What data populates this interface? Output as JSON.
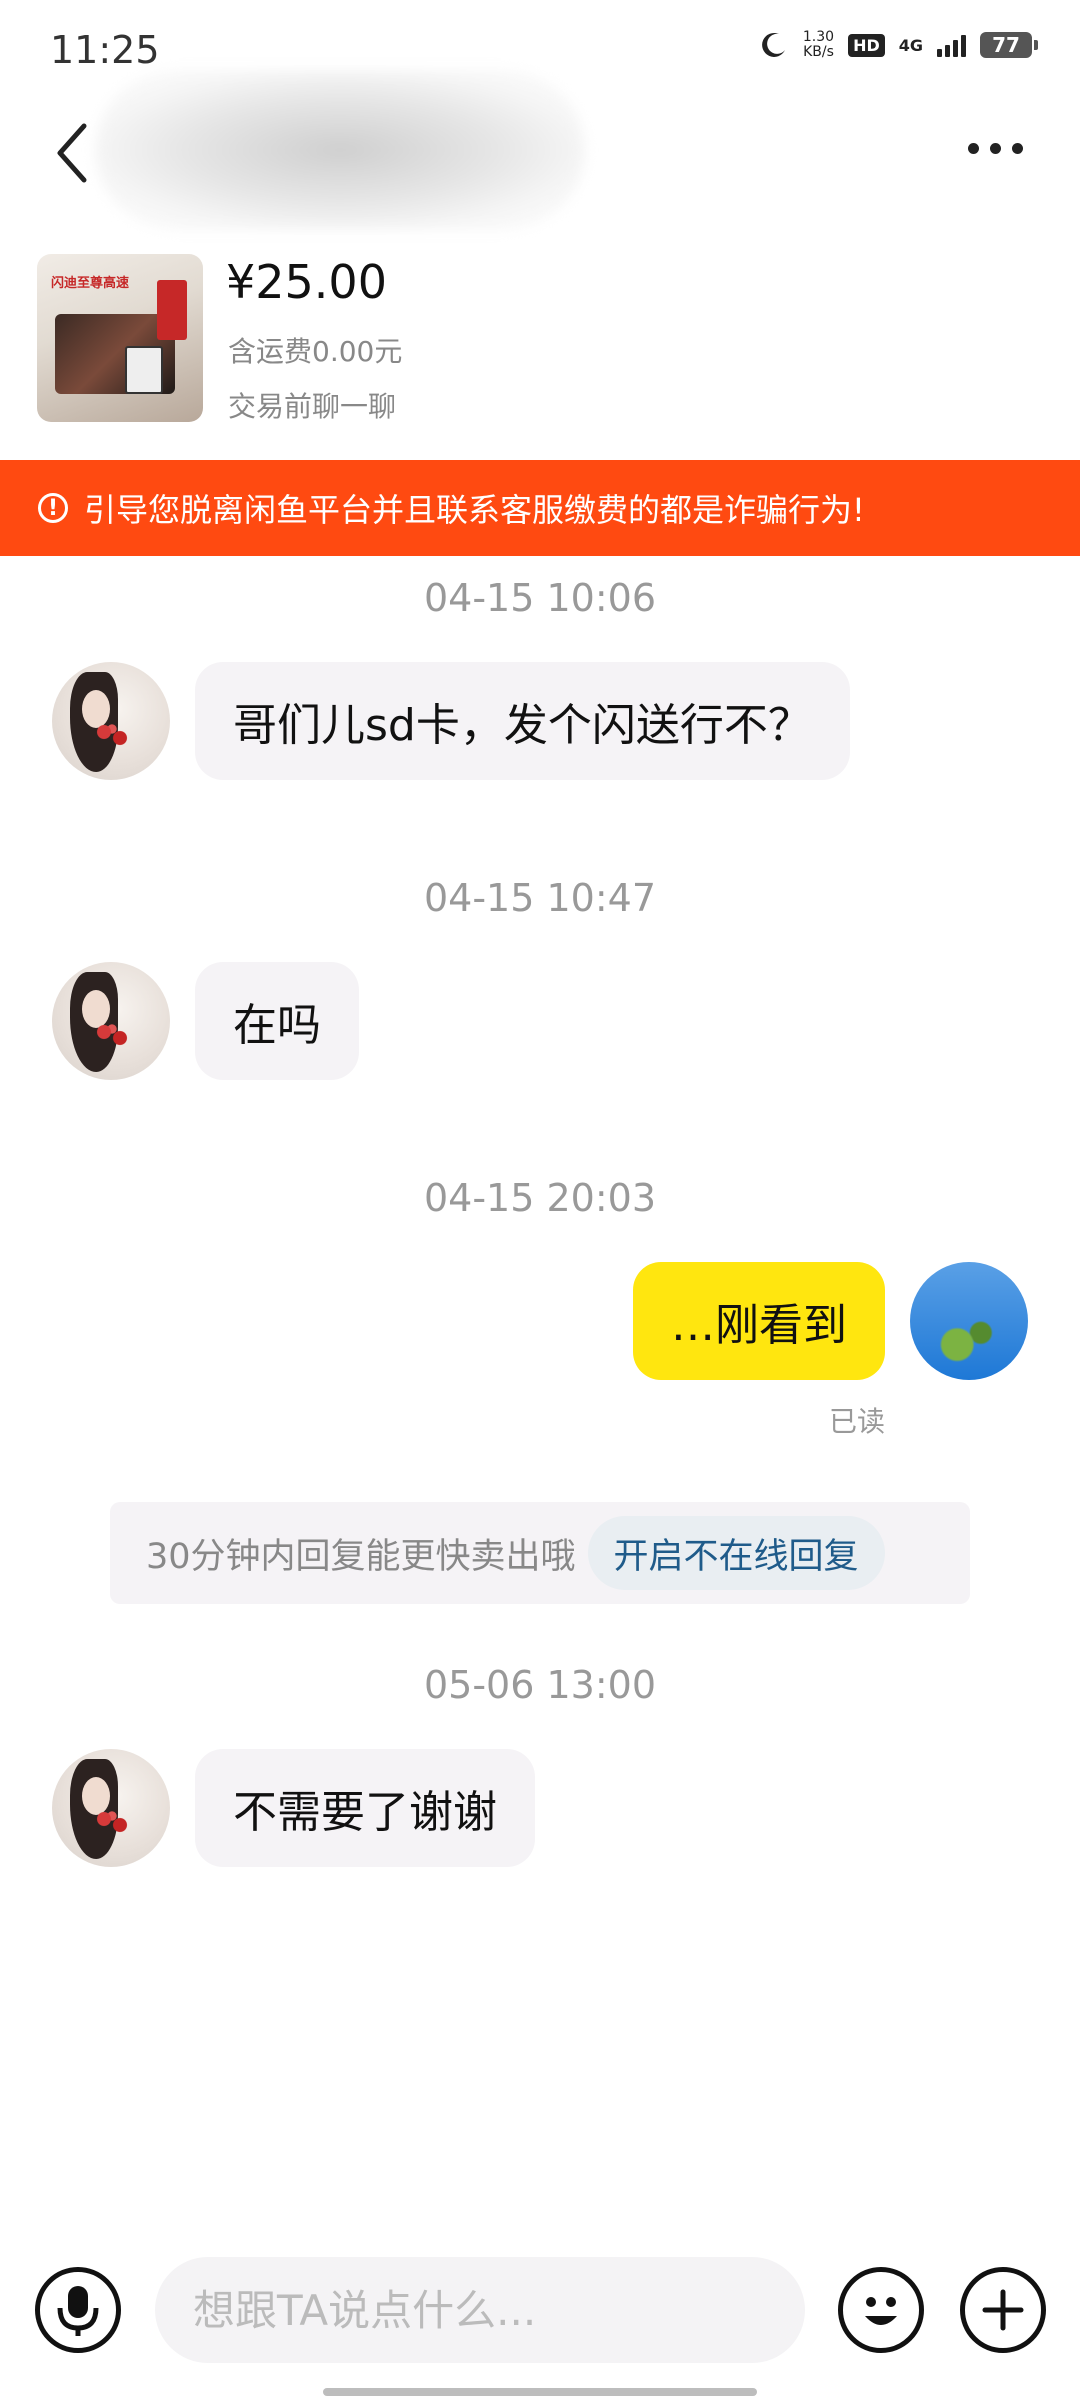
{
  "status_bar": {
    "time": "11:25",
    "speed_value": "1.30",
    "speed_unit": "KB/s",
    "hd": "HD",
    "network": "4G",
    "battery": "77"
  },
  "nav": {
    "back_icon": "chevron-left-icon",
    "more_icon": "more-horizontal-icon"
  },
  "product": {
    "price": "¥25.00",
    "shipping": "含运费0.00元",
    "chat_hint": "交易前聊一聊",
    "thumb_text": "闪迪至尊高速"
  },
  "warning": {
    "icon": "!",
    "text": "引导您脱离闲鱼平台并且联系客服缴费的都是诈骗行为!"
  },
  "messages": [
    {
      "timestamp": "04-15 10:06",
      "direction": "in",
      "text": "哥们儿sd卡，发个闪送行不？"
    },
    {
      "timestamp": "04-15 10:47",
      "direction": "in",
      "text": "在吗"
    },
    {
      "timestamp": "04-15 20:03",
      "direction": "out",
      "text": "…刚看到",
      "status": "已读"
    },
    {
      "timestamp": "05-06 13:00",
      "direction": "in",
      "text": "不需要了谢谢"
    }
  ],
  "promo": {
    "text": "30分钟内回复能更快卖出哦",
    "button": "开启不在线回复"
  },
  "input_bar": {
    "placeholder": "想跟TA说点什么...",
    "voice_icon": "microphone-icon",
    "emoji_icon": "emoji-icon",
    "plus_icon": "plus-icon"
  },
  "colors": {
    "warning_bg": "#ff4a11",
    "outgoing_bubble": "#ffe60f",
    "incoming_bubble": "#f5f3f6",
    "promo_button_text": "#1f5b8a"
  }
}
